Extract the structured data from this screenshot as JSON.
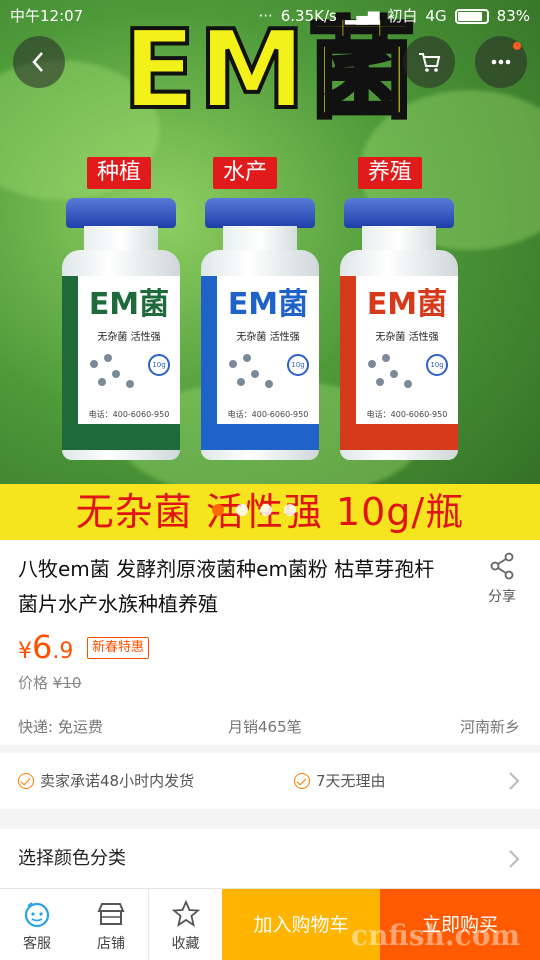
{
  "status_bar": {
    "time": "中午12:07",
    "network_speed": "6.35K/s",
    "carrier": "初白",
    "network_type": "4G",
    "battery": "83%"
  },
  "hero": {
    "title": "EM菌",
    "tags": [
      "种植",
      "水产",
      "养殖"
    ],
    "bottles": [
      {
        "brand": "EM菌",
        "subtitle": "无杂菌 活性强",
        "weight": "10g",
        "phone": "电话：400-6060-950",
        "color": "#1e6a3a"
      },
      {
        "brand": "EM菌",
        "subtitle": "无杂菌 活性强",
        "weight": "10g",
        "phone": "电话：400-6060-950",
        "color": "#1f63c8"
      },
      {
        "brand": "EM菌",
        "subtitle": "无杂菌 活性强",
        "weight": "10g",
        "phone": "电话：400-6060-950",
        "color": "#d63a1a"
      }
    ],
    "banner": "无杂菌 活性强 10g/瓶",
    "pager_active": 0,
    "pager_total": 4
  },
  "product": {
    "title": "八牧em菌 发酵剂原液菌种em菌粉 枯草芽孢杆菌片水产水族种植养殖",
    "share_label": "分享",
    "price_symbol": "¥",
    "price_int": "6",
    "price_dec": ".9",
    "promo_badge": "新春特惠",
    "orig_label": "价格",
    "orig_price": "¥10",
    "shipping": "快递: 免运费",
    "monthly_sales": "月销465笔",
    "location": "河南新乡"
  },
  "promises": [
    "卖家承诺48小时内发货",
    "7天无理由"
  ],
  "spec": {
    "label": "选择颜色分类"
  },
  "bottom_bar": {
    "service": "客服",
    "shop": "店铺",
    "favorite": "收藏",
    "add_cart": "加入购物车",
    "buy_now": "立即购买"
  },
  "watermark": "cnfish.com",
  "colors": {
    "accent": "#ff5000",
    "cart": "#ffb400",
    "buy": "#ff5a00"
  }
}
